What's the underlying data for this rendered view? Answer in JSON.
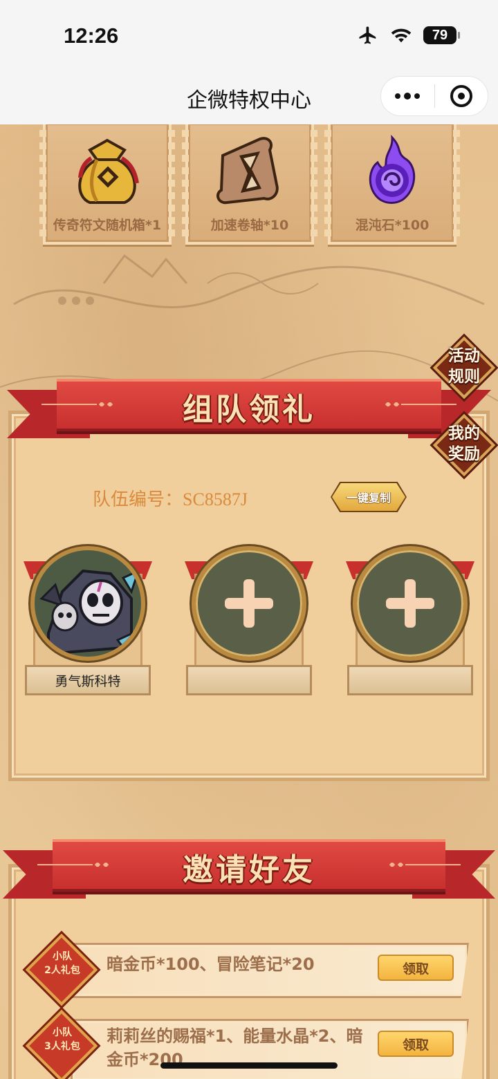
{
  "status_bar": {
    "time": "12:26",
    "battery": "79"
  },
  "nav": {
    "title": "企微特权中心"
  },
  "rewards": [
    {
      "label": "传奇符文随机箱*1",
      "icon": "gold-pouch-icon"
    },
    {
      "label": "加速卷轴*10",
      "icon": "hourglass-scroll-icon"
    },
    {
      "label": "混沌石*100",
      "icon": "purple-flame-orb-icon"
    }
  ],
  "side": {
    "rules": "活动\n规则",
    "my_rewards": "我的\n奖励"
  },
  "team": {
    "banner": "组队领礼",
    "team_id_label": "队伍编号：",
    "team_id": "SC8587J",
    "copy_label": "一键复制",
    "members": [
      {
        "name": "勇气斯科特",
        "filled": true
      },
      {
        "name": "",
        "filled": false
      },
      {
        "name": "",
        "filled": false
      }
    ]
  },
  "invite": {
    "banner": "邀请好友",
    "rows": [
      {
        "badge_line1": "小队",
        "badge_line2": "2人礼包",
        "desc": "暗金币*100、冒险笔记*20",
        "claim": "领取"
      },
      {
        "badge_line1": "小队",
        "badge_line2": "3人礼包",
        "desc": "莉莉丝的赐福*1、能量水晶*2、暗金币*200",
        "claim": "领取"
      }
    ]
  },
  "colors": {
    "banner_red": "#c8302f",
    "claim_gold": "#f3b43f",
    "team_id_orange": "#d98a3c"
  }
}
